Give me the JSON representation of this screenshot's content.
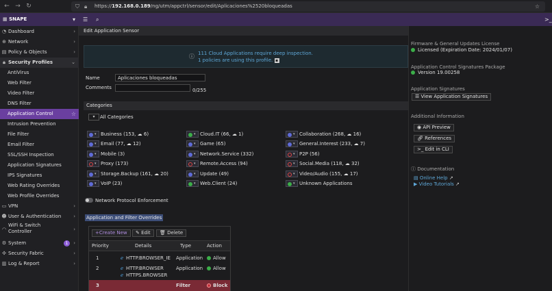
{
  "browser": {
    "url_prefix": "https://",
    "url_host": "192.168.0.189",
    "url_path": "/ng/utm/appctrl/sensor/edit/Aplicaciones%2520bloqueadas"
  },
  "app": {
    "brand": "SNAPE"
  },
  "sidebar": {
    "items": [
      {
        "label": "Dashboard"
      },
      {
        "label": "Network"
      },
      {
        "label": "Policy & Objects"
      },
      {
        "label": "Security Profiles"
      },
      {
        "label": "AntiVirus"
      },
      {
        "label": "Web Filter"
      },
      {
        "label": "Video Filter"
      },
      {
        "label": "DNS Filter"
      },
      {
        "label": "Application Control"
      },
      {
        "label": "Intrusion Prevention"
      },
      {
        "label": "File Filter"
      },
      {
        "label": "Email Filter"
      },
      {
        "label": "SSL/SSH Inspection"
      },
      {
        "label": "Application Signatures"
      },
      {
        "label": "IPS Signatures"
      },
      {
        "label": "Web Rating Overrides"
      },
      {
        "label": "Web Profile Overrides"
      },
      {
        "label": "VPN"
      },
      {
        "label": "User & Authentication"
      },
      {
        "label": "WiFi & Switch"
      },
      {
        "label": "System",
        "badge": "1"
      },
      {
        "label": "Security Fabric"
      },
      {
        "label": "Log & Report"
      }
    ],
    "wifi_line2": "Controller"
  },
  "main": {
    "title": "Edit Application Sensor",
    "notice_line1": "111 Cloud Applications require deep inspection.",
    "notice_line2": "1 policies are using this profile.",
    "name_label": "Name",
    "name_value": "Aplicaciones bloqueadas",
    "comments_label": "Comments",
    "comments_counter": "0/255",
    "categories_title": "Categories",
    "all_categories": "All Categories",
    "categories": [
      {
        "name": "Business (153, ☁ 6)",
        "action": "monitor"
      },
      {
        "name": "Cloud.IT (66, ☁ 1)",
        "action": "allow"
      },
      {
        "name": "Collaboration (268, ☁ 16)",
        "action": "monitor"
      },
      {
        "name": "Email (77, ☁ 12)",
        "action": "monitor"
      },
      {
        "name": "Game (65)",
        "action": "monitor"
      },
      {
        "name": "General.Interest (233, ☁ 7)",
        "action": "monitor"
      },
      {
        "name": "Mobile (3)",
        "action": "monitor"
      },
      {
        "name": "Network.Service (332)",
        "action": "monitor"
      },
      {
        "name": "P2P (56)",
        "action": "block"
      },
      {
        "name": "Proxy (173)",
        "action": "block"
      },
      {
        "name": "Remote.Access (94)",
        "action": "block"
      },
      {
        "name": "Social.Media (118, ☁ 32)",
        "action": "block"
      },
      {
        "name": "Storage.Backup (161, ☁ 20)",
        "action": "monitor"
      },
      {
        "name": "Update (49)",
        "action": "monitor"
      },
      {
        "name": "Video/Audio (155, ☁ 17)",
        "action": "block"
      },
      {
        "name": "VoIP (23)",
        "action": "monitor"
      },
      {
        "name": "Web.Client (24)",
        "action": "allow"
      },
      {
        "name": "Unknown Applications",
        "action": "allow"
      }
    ],
    "network_protocol": "Network Protocol Enforcement",
    "overrides_title": "Application and Filter Overrides",
    "overrides": {
      "create_new": "+Create New",
      "edit": "Edit",
      "delete": "Delete",
      "headers": [
        "Priority",
        "Details",
        "Type",
        "Action"
      ],
      "rows": [
        {
          "priority": "1",
          "details": [
            "HTTP.BROWSER_IE"
          ],
          "type": "Application",
          "action": "Allow"
        },
        {
          "priority": "2",
          "details": [
            "HTTP.BROWSER",
            "HTTPS.BROWSER"
          ],
          "type": "Application",
          "action": "Allow"
        },
        {
          "priority": "3",
          "details": [
            ""
          ],
          "type": "Filter",
          "action": "Block"
        }
      ]
    }
  },
  "right_panel": {
    "license_title": "Firmware & General Updates License",
    "license_status": "Licensed (Expiration Date: 2024/01/07)",
    "sig_pkg_title": "Application Control Signatures Package",
    "sig_pkg_version": "Version 19.00258",
    "app_sig_title": "Application Signatures",
    "view_app_sig": "View Application Signatures",
    "additional_title": "Additional Information",
    "api_preview": "API Preview",
    "references": "References",
    "edit_in_cli": "Edit in CLI",
    "documentation_title": "Documentation",
    "online_help": "Online Help",
    "video_tutorials": "Video Tutorials"
  }
}
